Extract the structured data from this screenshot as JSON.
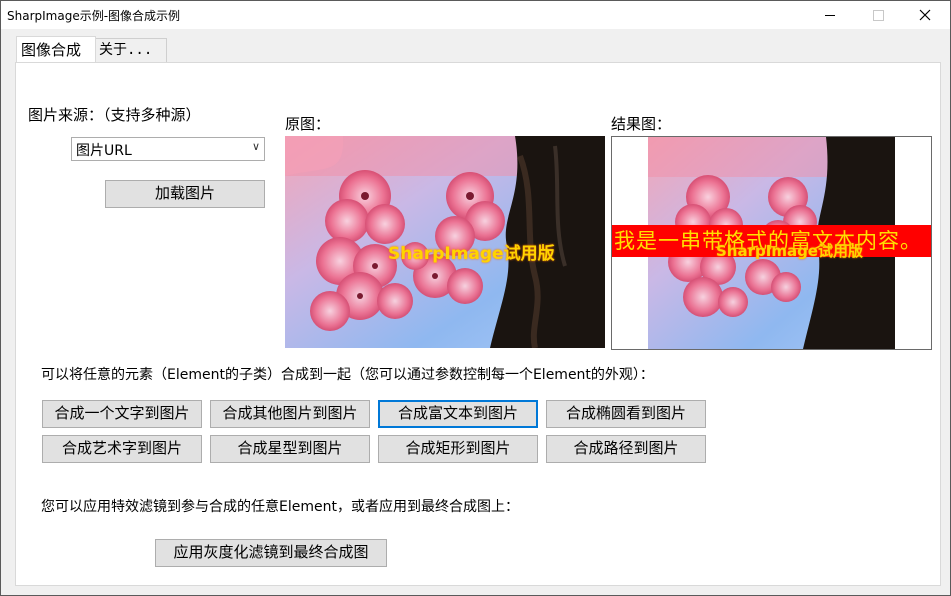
{
  "window": {
    "title": "SharpImage示例-图像合成示例"
  },
  "tabs": [
    {
      "label": "图像合成"
    },
    {
      "label": "关于..."
    }
  ],
  "source": {
    "label": "图片来源：（支持多种源）",
    "selected": "图片URL",
    "load_button": "加载图片"
  },
  "original": {
    "label": "原图：",
    "watermark": "SharpImage试用版"
  },
  "result": {
    "label": "结果图：",
    "rich_text": "我是一串带格式的富文本内容。",
    "watermark": "SharpImage试用版"
  },
  "compose": {
    "description": "可以将任意的元素（Element的子类）合成到一起（您可以通过参数控制每一个Element的外观）：",
    "buttons": [
      "合成一个文字到图片",
      "合成其他图片到图片",
      "合成富文本到图片",
      "合成椭圆看到图片",
      "合成艺术字到图片",
      "合成星型到图片",
      "合成矩形到图片",
      "合成路径到图片"
    ]
  },
  "filter": {
    "description": "您可以应用特效滤镜到参与合成的任意Element，或者应用到最终合成图上：",
    "button": "应用灰度化滤镜到最终合成图"
  },
  "colors": {
    "accent": "#0078d7",
    "rich_band": "#ff0000",
    "watermark": "#ffd400"
  },
  "icons": [
    "minimize-icon",
    "maximize-icon",
    "close-icon",
    "chevron-down-icon"
  ]
}
